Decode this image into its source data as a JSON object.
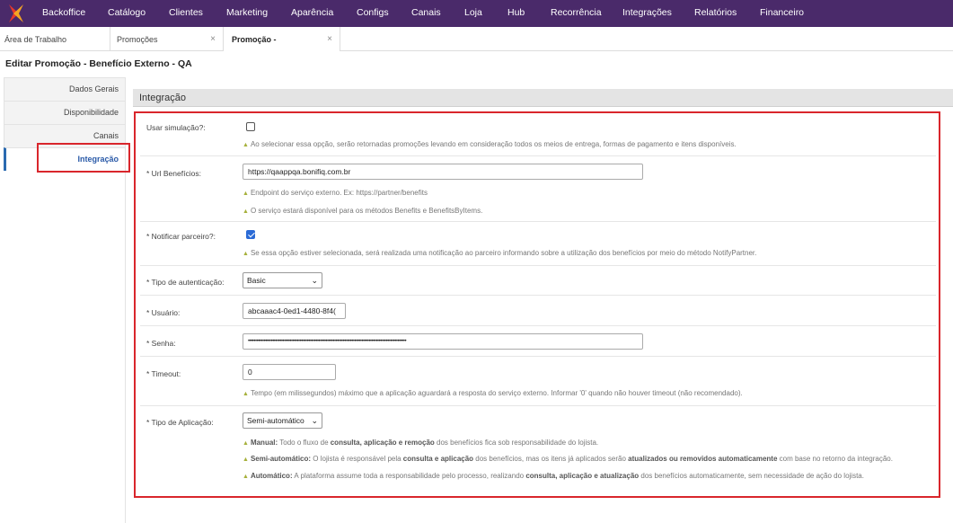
{
  "nav": {
    "items": [
      "Backoffice",
      "Catálogo",
      "Clientes",
      "Marketing",
      "Aparência",
      "Configs",
      "Canais",
      "Loja",
      "Hub",
      "Recorrência",
      "Integrações",
      "Relatórios",
      "Financeiro"
    ],
    "bg_color": "#4a2a6a",
    "logo_colors": [
      "#e8392b",
      "#f5a623"
    ]
  },
  "tabs": [
    {
      "label": "Área de Trabalho",
      "closable": false
    },
    {
      "label": "Promoções",
      "closable": true,
      "close": "×"
    },
    {
      "label": "Promoção -",
      "closable": true,
      "close": "×",
      "active": true
    }
  ],
  "page_title": "Editar Promoção - Benefício Externo - QA",
  "sidebar": {
    "items": [
      "Dados Gerais",
      "Disponibilidade",
      "Canais",
      "Integração"
    ],
    "active": "Integração"
  },
  "section": {
    "title": "Integração"
  },
  "form": {
    "simulacao": {
      "label": "Usar simulação?:",
      "checked": false,
      "hint": "Ao selecionar essa opção, serão retornadas promoções levando em consideração todos os meios de entrega, formas de pagamento e itens disponíveis."
    },
    "url": {
      "label": "* Url Benefícios:",
      "value": "https://qaappqa.bonifiq.com.br",
      "hint1": "Endpoint do serviço externo. Ex: https://partner/benefits",
      "hint2": "O serviço estará disponível para os métodos Benefits e BenefitsByItems."
    },
    "notificar": {
      "label": "* Notificar parceiro?:",
      "checked": true,
      "hint": "Se essa opção estiver selecionada, será realizada uma notificação ao parceiro informando sobre a utilização dos benefícios por meio do método NotifyPartner."
    },
    "auth": {
      "label": "* Tipo de autenticação:",
      "value": "Basic"
    },
    "usuario": {
      "label": "* Usuário:",
      "value": "abcaaac4-0ed1-4480-8f4("
    },
    "senha": {
      "label": "* Senha:",
      "value": "••••••••••••••••••••••••••••••••••••••••••••••••••••••••••••••••••••••••••••••••••••••••••••••••••••••••••••••"
    },
    "timeout": {
      "label": "* Timeout:",
      "value": "0",
      "hint": "Tempo (em milissegundos) máximo que a aplicação aguardará a resposta do serviço externo. Informar '0' quando não houver timeout (não recomendado)."
    },
    "aplicacao": {
      "label": "* Tipo de Aplicação:",
      "value": "Semi-automático",
      "manual": {
        "t": "Manual:",
        "a": " Todo o fluxo de ",
        "b": "consulta, aplicação e remoção",
        "c": " dos benefícios fica sob responsabilidade do lojista."
      },
      "semi": {
        "t": "Semi-automático:",
        "a": " O lojista é responsável pela ",
        "b": "consulta e aplicação",
        "c": " dos benefícios, mas os itens já aplicados serão ",
        "d": "atualizados ou removidos automaticamente",
        "e": " com base no retorno da integração."
      },
      "auto": {
        "t": "Automático:",
        "a": " A plataforma assume toda a responsabilidade pelo processo, realizando ",
        "b": "consulta, aplicação e atualização",
        "c": " dos benefícios automaticamente, sem necessidade de ação do lojista."
      }
    }
  },
  "colors": {
    "highlight": "#d9262c",
    "accent": "#2b6bd6",
    "hint_marker": "#a6b03a"
  }
}
